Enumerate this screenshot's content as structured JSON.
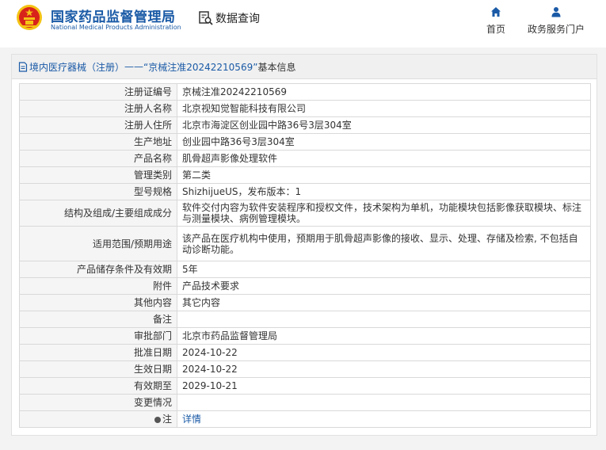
{
  "header": {
    "brand_cn": "国家药品监督管理局",
    "brand_en": "National Medical Products Administration",
    "query_label": "数据查询",
    "nav": {
      "home": "首页",
      "service": "政务服务门户"
    },
    "colors": {
      "brand": "#1a5aa6",
      "emblem_red": "#d8231b",
      "emblem_gold": "#f4c315"
    }
  },
  "panel": {
    "title_prefix": "境内医疗器械（注册）",
    "title_dash": "——",
    "title_record": "“京械注准20242210569”",
    "title_suffix": "基本信息"
  },
  "rows": [
    {
      "label": "注册证编号",
      "value": "京械注准20242210569"
    },
    {
      "label": "注册人名称",
      "value": "北京视知觉智能科技有限公司"
    },
    {
      "label": "注册人住所",
      "value": "北京市海淀区创业园中路36号3层304室"
    },
    {
      "label": "生产地址",
      "value": "创业园中路36号3层304室"
    },
    {
      "label": "产品名称",
      "value": "肌骨超声影像处理软件"
    },
    {
      "label": "管理类别",
      "value": "第二类"
    },
    {
      "label": "型号规格",
      "value": "ShizhijueUS，发布版本：1"
    },
    {
      "label": "结构及组成/主要组成成分",
      "value": "软件交付内容为软件安装程序和授权文件，技术架构为单机，功能模块包括影像获取模块、标注与测量模块、病例管理模块。"
    },
    {
      "label": "适用范围/预期用途",
      "value": "该产品在医疗机构中使用，预期用于肌骨超声影像的接收、显示、处理、存储及检索, 不包括自动诊断功能。"
    },
    {
      "label": "产品储存条件及有效期",
      "value": "5年"
    },
    {
      "label": "附件",
      "value": "产品技术要求"
    },
    {
      "label": "其他内容",
      "value": "其它内容"
    },
    {
      "label": "备注",
      "value": ""
    },
    {
      "label": "审批部门",
      "value": "北京市药品监督管理局"
    },
    {
      "label": "批准日期",
      "value": "2024-10-22"
    },
    {
      "label": "生效日期",
      "value": "2024-10-22"
    },
    {
      "label": "有效期至",
      "value": "2029-10-21"
    },
    {
      "label": "变更情况",
      "value": ""
    },
    {
      "label": "注",
      "value": "详情"
    }
  ]
}
